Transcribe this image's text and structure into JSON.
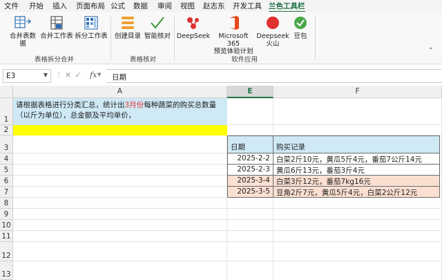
{
  "menu": {
    "tabs": [
      "文件",
      "开始",
      "插入",
      "页面布局",
      "公式",
      "数据",
      "审阅",
      "视图",
      "赵志东",
      "开发工具",
      "兰色工具栏"
    ],
    "active_index": 10
  },
  "ribbon": {
    "groups": [
      {
        "label": "表格拆分合并",
        "buttons": [
          "合并表数据",
          "合并工作表",
          "拆分工作表"
        ]
      },
      {
        "label": "表格核对",
        "buttons": [
          "创建目录",
          "智能核对"
        ]
      },
      {
        "label": "软件应用",
        "buttons": [
          "DeepSeek",
          "Microsoft 365\n预览体验计划",
          "Deepseek\n火山",
          "豆包"
        ]
      }
    ]
  },
  "formula_bar": {
    "name_box": "E3",
    "fx": "fx",
    "content": "日期"
  },
  "grid": {
    "columns": [
      "A",
      "E",
      "F"
    ],
    "selected_column": "E",
    "rows": [
      "1",
      "2",
      "3",
      "4",
      "5",
      "6",
      "7",
      "8",
      "9",
      "10",
      "11",
      "12",
      "13"
    ],
    "a1": {
      "part1": "请根据表格进行分类汇总，统计出",
      "highlight": "3月份",
      "part2": "每种蔬菜的购买总数量（以斤为单位），总金额及平均单价，"
    },
    "table": {
      "headers": [
        "日期",
        "购买记录"
      ],
      "rows": [
        {
          "date": "2025-2-2",
          "record": "白菜2斤10元，黄瓜5斤4元，番茄7公斤14元"
        },
        {
          "date": "2025-2-3",
          "record": "黄瓜6斤13元，番茄3斤4元"
        },
        {
          "date": "2025-3-4",
          "record": "白菜3斤12元，番茄7kg16元"
        },
        {
          "date": "2025-3-5",
          "record": "豆角2斤7元，黄瓜5斤4元，白菜2公斤12元"
        }
      ]
    }
  },
  "colors": {
    "accent": "#1e7145",
    "header_fill": "#cfe9f5",
    "highlight_fill": "#ffff00",
    "march_fill": "#fbe0d2",
    "red_text": "#e03030"
  }
}
